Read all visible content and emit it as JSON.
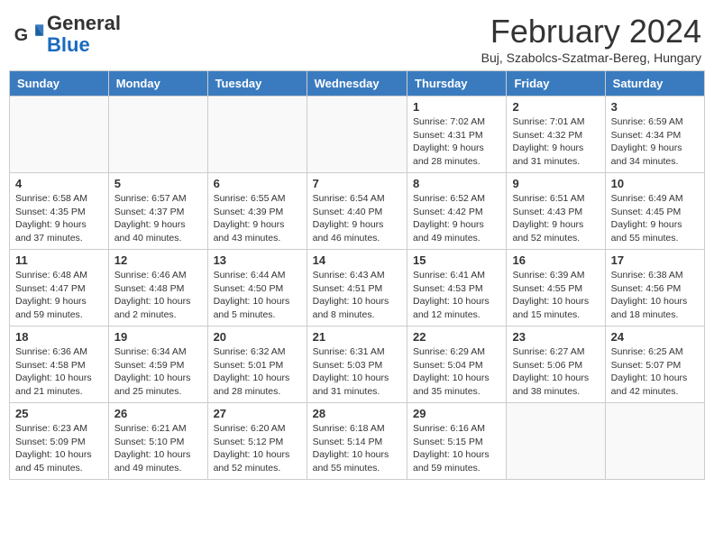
{
  "header": {
    "logo_general": "General",
    "logo_blue": "Blue",
    "cal_title": "February 2024",
    "cal_subtitle": "Buj, Szabolcs-Szatmar-Bereg, Hungary"
  },
  "days_of_week": [
    "Sunday",
    "Monday",
    "Tuesday",
    "Wednesday",
    "Thursday",
    "Friday",
    "Saturday"
  ],
  "weeks": [
    [
      {
        "day": "",
        "info": ""
      },
      {
        "day": "",
        "info": ""
      },
      {
        "day": "",
        "info": ""
      },
      {
        "day": "",
        "info": ""
      },
      {
        "day": "1",
        "info": "Sunrise: 7:02 AM\nSunset: 4:31 PM\nDaylight: 9 hours and 28 minutes."
      },
      {
        "day": "2",
        "info": "Sunrise: 7:01 AM\nSunset: 4:32 PM\nDaylight: 9 hours and 31 minutes."
      },
      {
        "day": "3",
        "info": "Sunrise: 6:59 AM\nSunset: 4:34 PM\nDaylight: 9 hours and 34 minutes."
      }
    ],
    [
      {
        "day": "4",
        "info": "Sunrise: 6:58 AM\nSunset: 4:35 PM\nDaylight: 9 hours and 37 minutes."
      },
      {
        "day": "5",
        "info": "Sunrise: 6:57 AM\nSunset: 4:37 PM\nDaylight: 9 hours and 40 minutes."
      },
      {
        "day": "6",
        "info": "Sunrise: 6:55 AM\nSunset: 4:39 PM\nDaylight: 9 hours and 43 minutes."
      },
      {
        "day": "7",
        "info": "Sunrise: 6:54 AM\nSunset: 4:40 PM\nDaylight: 9 hours and 46 minutes."
      },
      {
        "day": "8",
        "info": "Sunrise: 6:52 AM\nSunset: 4:42 PM\nDaylight: 9 hours and 49 minutes."
      },
      {
        "day": "9",
        "info": "Sunrise: 6:51 AM\nSunset: 4:43 PM\nDaylight: 9 hours and 52 minutes."
      },
      {
        "day": "10",
        "info": "Sunrise: 6:49 AM\nSunset: 4:45 PM\nDaylight: 9 hours and 55 minutes."
      }
    ],
    [
      {
        "day": "11",
        "info": "Sunrise: 6:48 AM\nSunset: 4:47 PM\nDaylight: 9 hours and 59 minutes."
      },
      {
        "day": "12",
        "info": "Sunrise: 6:46 AM\nSunset: 4:48 PM\nDaylight: 10 hours and 2 minutes."
      },
      {
        "day": "13",
        "info": "Sunrise: 6:44 AM\nSunset: 4:50 PM\nDaylight: 10 hours and 5 minutes."
      },
      {
        "day": "14",
        "info": "Sunrise: 6:43 AM\nSunset: 4:51 PM\nDaylight: 10 hours and 8 minutes."
      },
      {
        "day": "15",
        "info": "Sunrise: 6:41 AM\nSunset: 4:53 PM\nDaylight: 10 hours and 12 minutes."
      },
      {
        "day": "16",
        "info": "Sunrise: 6:39 AM\nSunset: 4:55 PM\nDaylight: 10 hours and 15 minutes."
      },
      {
        "day": "17",
        "info": "Sunrise: 6:38 AM\nSunset: 4:56 PM\nDaylight: 10 hours and 18 minutes."
      }
    ],
    [
      {
        "day": "18",
        "info": "Sunrise: 6:36 AM\nSunset: 4:58 PM\nDaylight: 10 hours and 21 minutes."
      },
      {
        "day": "19",
        "info": "Sunrise: 6:34 AM\nSunset: 4:59 PM\nDaylight: 10 hours and 25 minutes."
      },
      {
        "day": "20",
        "info": "Sunrise: 6:32 AM\nSunset: 5:01 PM\nDaylight: 10 hours and 28 minutes."
      },
      {
        "day": "21",
        "info": "Sunrise: 6:31 AM\nSunset: 5:03 PM\nDaylight: 10 hours and 31 minutes."
      },
      {
        "day": "22",
        "info": "Sunrise: 6:29 AM\nSunset: 5:04 PM\nDaylight: 10 hours and 35 minutes."
      },
      {
        "day": "23",
        "info": "Sunrise: 6:27 AM\nSunset: 5:06 PM\nDaylight: 10 hours and 38 minutes."
      },
      {
        "day": "24",
        "info": "Sunrise: 6:25 AM\nSunset: 5:07 PM\nDaylight: 10 hours and 42 minutes."
      }
    ],
    [
      {
        "day": "25",
        "info": "Sunrise: 6:23 AM\nSunset: 5:09 PM\nDaylight: 10 hours and 45 minutes."
      },
      {
        "day": "26",
        "info": "Sunrise: 6:21 AM\nSunset: 5:10 PM\nDaylight: 10 hours and 49 minutes."
      },
      {
        "day": "27",
        "info": "Sunrise: 6:20 AM\nSunset: 5:12 PM\nDaylight: 10 hours and 52 minutes."
      },
      {
        "day": "28",
        "info": "Sunrise: 6:18 AM\nSunset: 5:14 PM\nDaylight: 10 hours and 55 minutes."
      },
      {
        "day": "29",
        "info": "Sunrise: 6:16 AM\nSunset: 5:15 PM\nDaylight: 10 hours and 59 minutes."
      },
      {
        "day": "",
        "info": ""
      },
      {
        "day": "",
        "info": ""
      }
    ]
  ]
}
